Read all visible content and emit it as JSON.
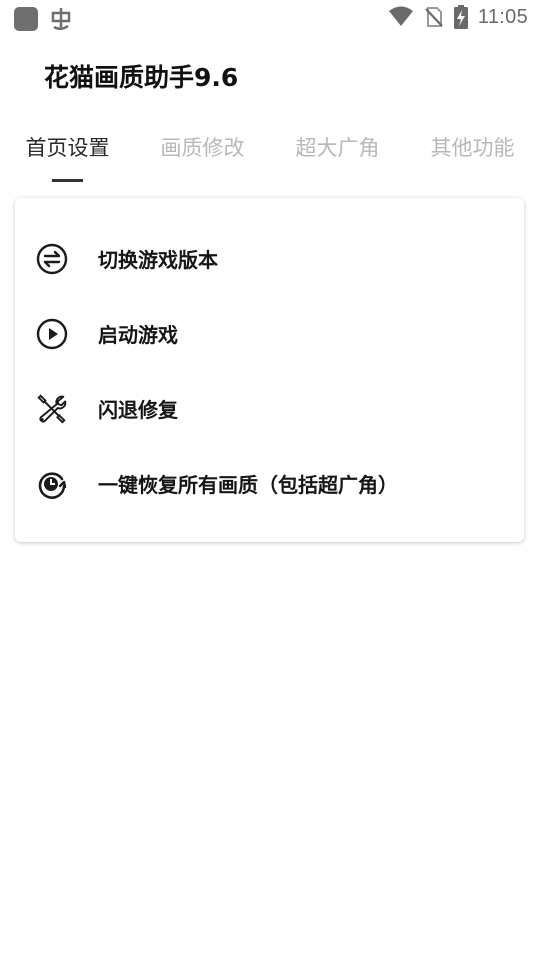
{
  "status_bar": {
    "time": "11:05",
    "left_icons": [
      "app-square-icon",
      "bug-icon"
    ],
    "right_icons": [
      "wifi-icon",
      "no-sim-icon",
      "battery-charging-icon"
    ]
  },
  "app": {
    "title": "花猫画质助手9.6"
  },
  "tabs": [
    {
      "label": "首页设置",
      "active": true
    },
    {
      "label": "画质修改",
      "active": false
    },
    {
      "label": "超大广角",
      "active": false
    },
    {
      "label": "其他功能",
      "active": false
    }
  ],
  "menu": {
    "items": [
      {
        "label": "切换游戏版本",
        "icon": "switch-arrows-icon"
      },
      {
        "label": "启动游戏",
        "icon": "play-circle-icon"
      },
      {
        "label": "闪退修复",
        "icon": "tools-icon"
      },
      {
        "label": "一键恢复所有画质（包括超广角）",
        "icon": "restore-icon"
      }
    ]
  }
}
